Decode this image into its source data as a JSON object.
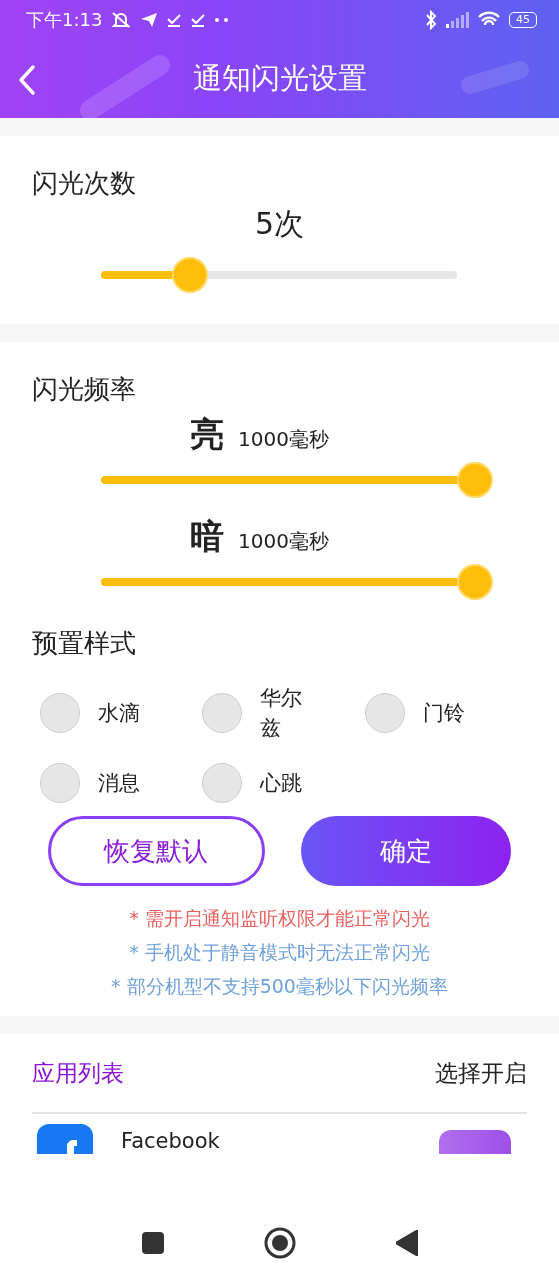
{
  "status_bar": {
    "time": "下午1:13",
    "battery": "45"
  },
  "header": {
    "title": "通知闪光设置"
  },
  "flash_count": {
    "label": "闪光次数",
    "reading": "5次",
    "level": 0.25
  },
  "flash_frequency": {
    "label": "闪光频率",
    "sliders": [
      {
        "name": "亮",
        "reading": "1000毫秒",
        "level": 1
      },
      {
        "name": "暗",
        "reading": "1000毫秒",
        "level": 1
      }
    ]
  },
  "presets": {
    "label": "预置样式",
    "options": [
      {
        "label": "水滴",
        "selected": false
      },
      {
        "label": "华尔兹",
        "selected": false
      },
      {
        "label": "门铃",
        "selected": false
      },
      {
        "label": "消息",
        "selected": false
      },
      {
        "label": "心跳",
        "selected": false
      }
    ]
  },
  "buttons": [
    {
      "label": "恢复默认",
      "kind": "outline"
    },
    {
      "label": "确定",
      "kind": "filled"
    }
  ],
  "notes": [
    {
      "text": "* 需开启通知监听权限才能正常闪光",
      "kind": "warning"
    },
    {
      "text": "* 手机处于静音模式时无法正常闪光",
      "kind": "info"
    },
    {
      "text": "* 部分机型不支持500毫秒以下闪光频率",
      "kind": "info"
    }
  ],
  "app_list": {
    "title": "应用列表",
    "action": "选择开启",
    "apps": [
      {
        "name": "Facebook",
        "on": true
      }
    ]
  }
}
